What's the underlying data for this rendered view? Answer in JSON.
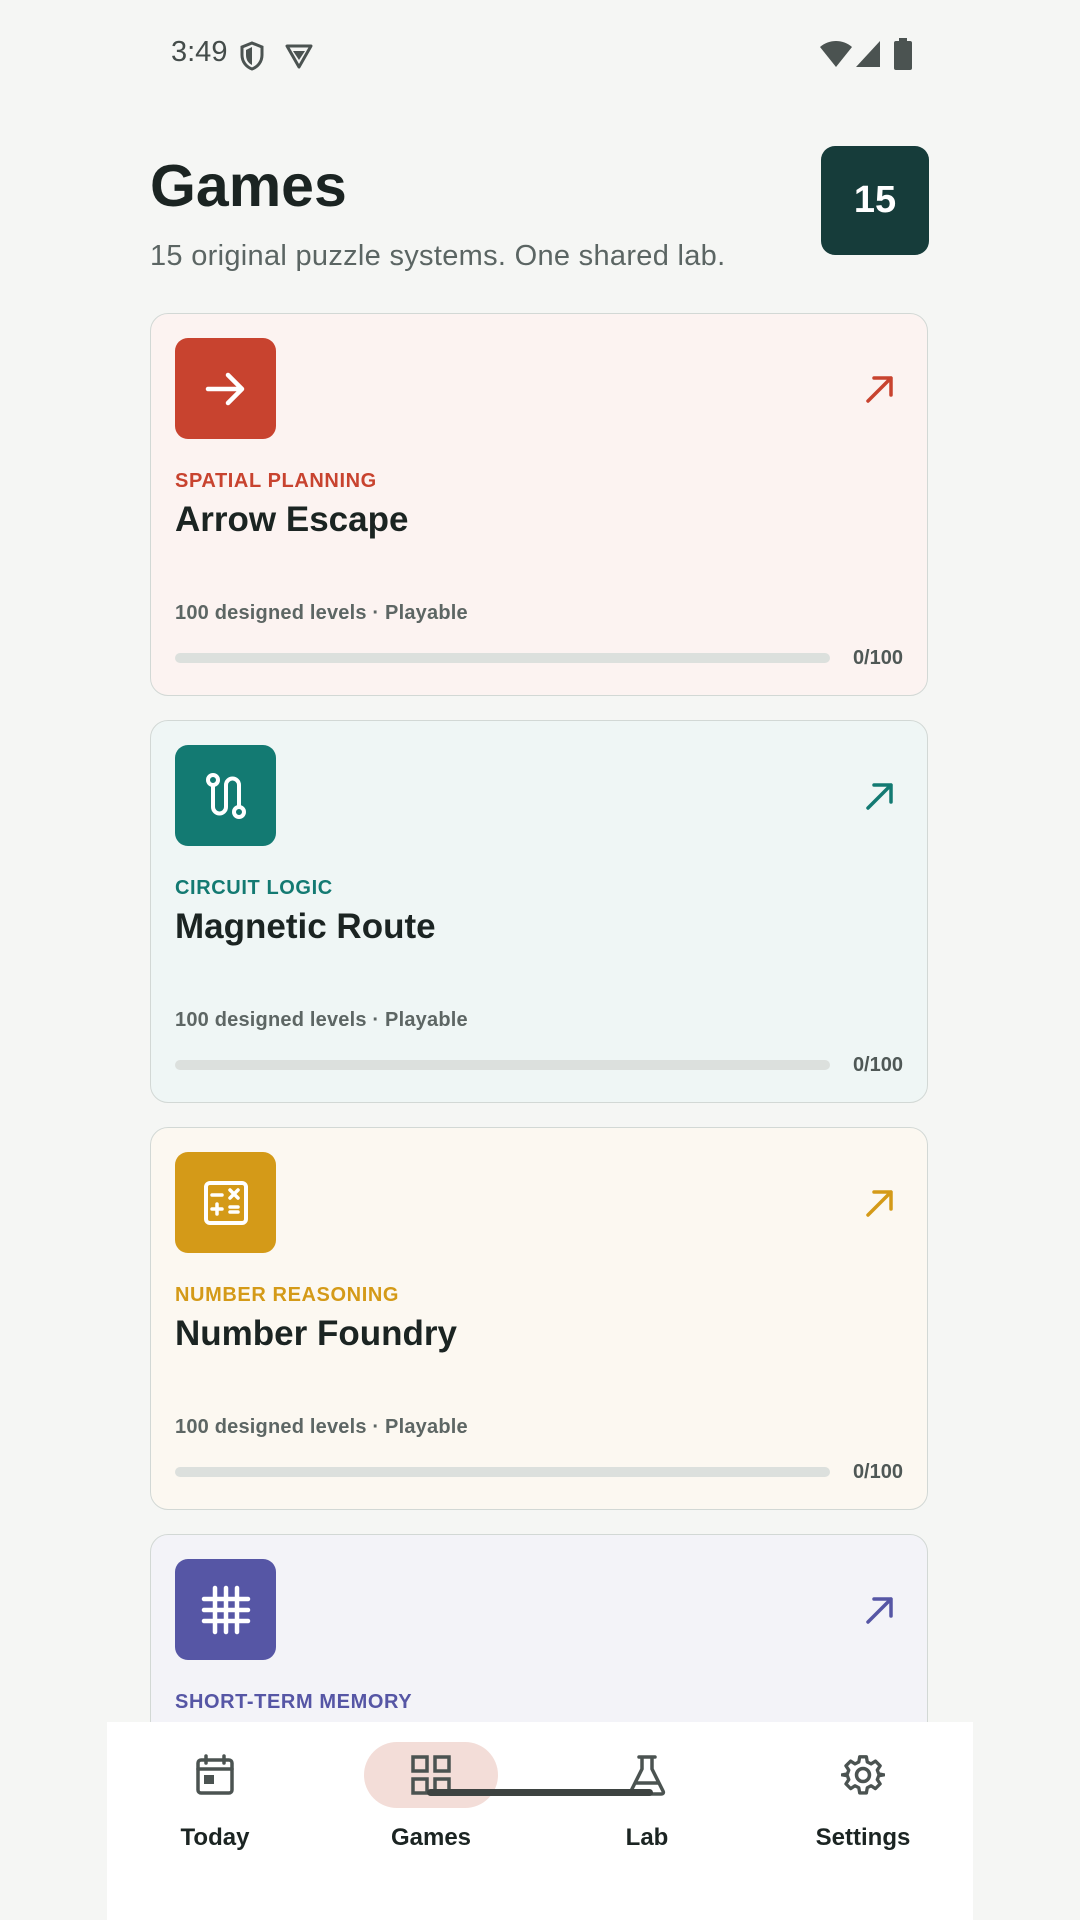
{
  "status_bar": {
    "time": "3:49",
    "left_icons": [
      "shield-icon",
      "vpn-icon"
    ],
    "right_icons": [
      "wifi-icon",
      "signal-icon",
      "battery-icon"
    ]
  },
  "header": {
    "title": "Games",
    "subtitle": "15 original puzzle systems. One shared lab.",
    "count": "15"
  },
  "games": [
    {
      "category": "SPATIAL PLANNING",
      "title": "Arrow Escape",
      "meta": "100 designed levels · Playable",
      "progress_text": "0/100",
      "progress": 0,
      "icon": "arrow-right-icon",
      "accent": "#c8432f",
      "tint": "#fcf3f1"
    },
    {
      "category": "CIRCUIT LOGIC",
      "title": "Magnetic Route",
      "meta": "100 designed levels · Playable",
      "progress_text": "0/100",
      "progress": 0,
      "icon": "route-icon",
      "accent": "#137a72",
      "tint": "#eff6f5"
    },
    {
      "category": "NUMBER REASONING",
      "title": "Number Foundry",
      "meta": "100 designed levels · Playable",
      "progress_text": "0/100",
      "progress": 0,
      "icon": "calculator-icon",
      "accent": "#d49a18",
      "tint": "#fcf8f1"
    },
    {
      "category": "SHORT-TERM MEMORY",
      "title": "",
      "meta": "",
      "progress_text": "",
      "progress": 0,
      "icon": "grid-icon",
      "accent": "#5656a5",
      "tint": "#f3f3f8"
    }
  ],
  "nav": {
    "items": [
      {
        "label": "Today",
        "icon": "calendar-icon",
        "active": false
      },
      {
        "label": "Games",
        "icon": "apps-grid-icon",
        "active": true
      },
      {
        "label": "Lab",
        "icon": "flask-icon",
        "active": false
      },
      {
        "label": "Settings",
        "icon": "gear-icon",
        "active": false
      }
    ],
    "active_color": "#f3ddd8"
  }
}
